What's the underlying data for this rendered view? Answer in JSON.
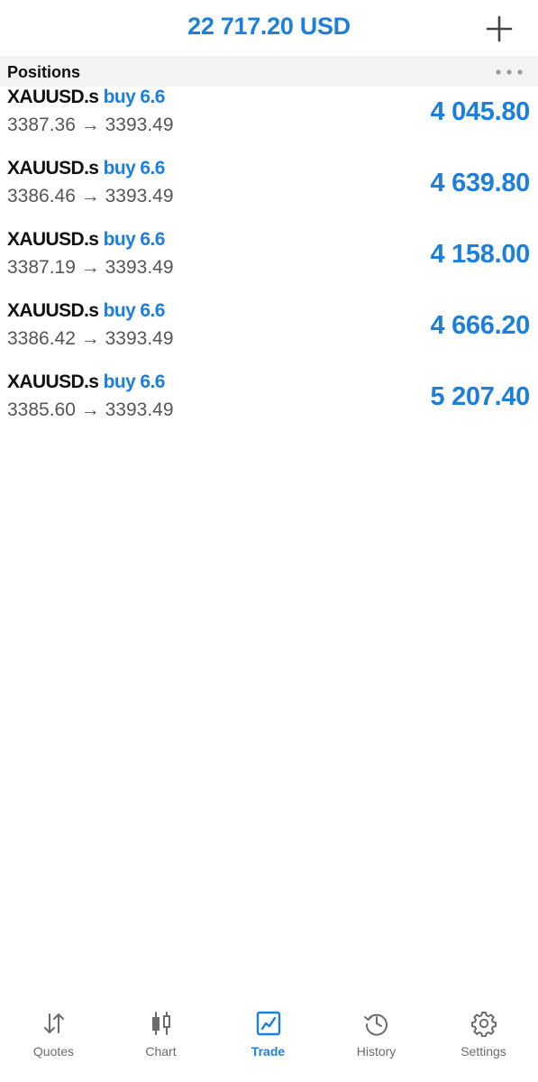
{
  "header": {
    "balance": "22 717.20 USD"
  },
  "section": {
    "title": "Positions"
  },
  "positions": [
    {
      "symbol": "XAUUSD.s",
      "side": "buy 6.6",
      "open_price": "3387.36",
      "arrow": "→",
      "current_price": "3393.49",
      "profit": "4 045.80"
    },
    {
      "symbol": "XAUUSD.s",
      "side": "buy 6.6",
      "open_price": "3386.46",
      "arrow": "→",
      "current_price": "3393.49",
      "profit": "4 639.80"
    },
    {
      "symbol": "XAUUSD.s",
      "side": "buy 6.6",
      "open_price": "3387.19",
      "arrow": "→",
      "current_price": "3393.49",
      "profit": "4 158.00"
    },
    {
      "symbol": "XAUUSD.s",
      "side": "buy 6.6",
      "open_price": "3386.42",
      "arrow": "→",
      "current_price": "3393.49",
      "profit": "4 666.20"
    },
    {
      "symbol": "XAUUSD.s",
      "side": "buy 6.6",
      "open_price": "3385.60",
      "arrow": "→",
      "current_price": "3393.49",
      "profit": "5 207.40"
    }
  ],
  "tabs": [
    {
      "label": "Quotes",
      "icon": "quotes-arrows-icon",
      "active": false
    },
    {
      "label": "Chart",
      "icon": "candlestick-chart-icon",
      "active": false
    },
    {
      "label": "Trade",
      "icon": "trade-line-chart-icon",
      "active": true
    },
    {
      "label": "History",
      "icon": "history-clock-icon",
      "active": false
    },
    {
      "label": "Settings",
      "icon": "gear-icon",
      "active": false
    }
  ],
  "colors": {
    "accent": "#1d7fdc",
    "text": "#111111",
    "secondary_text": "#555555",
    "inactive_tab": "#6b6b6b",
    "section_bg": "#f3f3f4"
  }
}
